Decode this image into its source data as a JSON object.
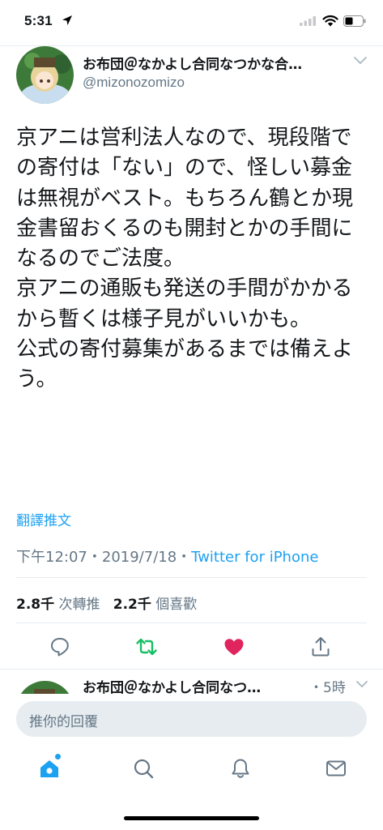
{
  "status_bar": {
    "time": "5:31",
    "icons": [
      "location-arrow-icon",
      "signal-icon",
      "wifi-icon",
      "battery-icon"
    ]
  },
  "tweet": {
    "display_name": "お布団＠なかよし合同なつかな合…",
    "handle": "@mizonozomizo",
    "text": "京アニは営利法人なので、現段階での寄付は「ない」ので、怪しい募金は無視がベスト。もちろん鶴とか現金書留おくるのも開封とかの手間になるのでご法度。\n京アニの通販も発送の手間がかかるから暫くは様子見がいいかも。\n公式の寄付募集があるまでは備えよう。",
    "translate_label": "翻譯推文",
    "time": "下午12:07",
    "separator": "・",
    "date": "2019/7/18",
    "source": "Twitter for iPhone",
    "retweet_count": "2.8千",
    "retweet_label": "次轉推",
    "like_count": "2.2千",
    "like_label": "個喜歡",
    "liked": true
  },
  "actions": {
    "icons": [
      "reply-icon",
      "retweet-icon",
      "like-icon",
      "share-icon"
    ],
    "colors": {
      "retweet": "#17bf63",
      "like": "#e0245e",
      "default": "#657786"
    }
  },
  "reply_preview": {
    "display_name": "お布団＠なかよし合同なつ…",
    "time": "・5時"
  },
  "composer": {
    "placeholder": "推你的回覆"
  },
  "tab_bar": {
    "icons": [
      "home-icon",
      "search-icon",
      "notifications-icon",
      "messages-icon"
    ],
    "active": "home",
    "accent": "#1da1f2"
  }
}
